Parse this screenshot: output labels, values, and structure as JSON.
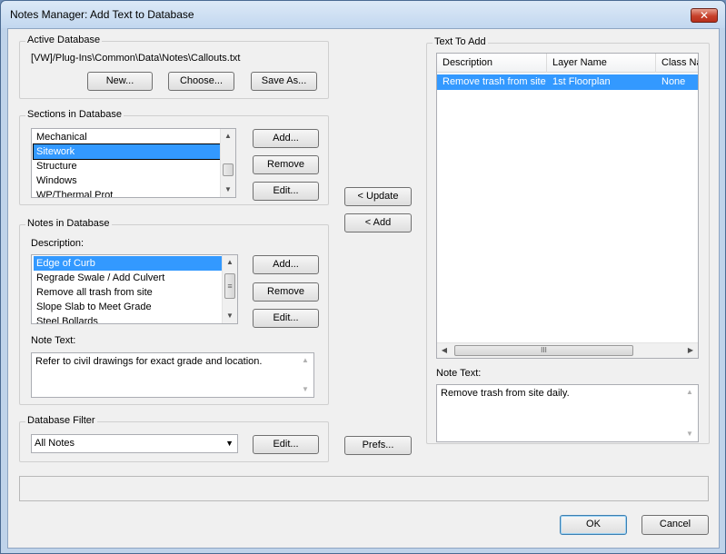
{
  "window": {
    "title": "Notes Manager: Add Text to Database",
    "close_glyph": "✕"
  },
  "active_database": {
    "title": "Active Database",
    "path": "[VW]/Plug-Ins\\Common\\Data\\Notes\\Callouts.txt",
    "new_label": "New...",
    "choose_label": "Choose...",
    "save_as_label": "Save As..."
  },
  "sections": {
    "title": "Sections in Database",
    "items": [
      "Mechanical",
      "Sitework",
      "Structure",
      "Windows",
      "WP/Thermal Prot"
    ],
    "selected": "Sitework",
    "add_label": "Add...",
    "remove_label": "Remove",
    "edit_label": "Edit..."
  },
  "notes": {
    "title": "Notes in Database",
    "description_label": "Description:",
    "items": [
      "Edge of Curb",
      "Regrade Swale / Add Culvert",
      "Remove all trash from site",
      "Slope Slab to Meet Grade",
      "Steel Bollards"
    ],
    "selected": "Edge of Curb",
    "add_label": "Add...",
    "remove_label": "Remove",
    "edit_label": "Edit...",
    "note_text_label": "Note Text:",
    "note_text": "Refer to civil drawings for exact grade and location."
  },
  "filter": {
    "title": "Database Filter",
    "value": "All Notes",
    "edit_label": "Edit..."
  },
  "middle": {
    "update_label": "< Update",
    "add_label": "< Add",
    "prefs_label": "Prefs..."
  },
  "text_to_add": {
    "title": "Text To Add",
    "columns": [
      "Description",
      "Layer Name",
      "Class Na"
    ],
    "row": {
      "description": "Remove trash from site",
      "layer": "1st Floorplan",
      "class": "None"
    },
    "note_text_label": "Note Text:",
    "note_text": "Remove trash from site daily."
  },
  "footer": {
    "ok_label": "OK",
    "cancel_label": "Cancel"
  },
  "colors": {
    "selection": "#3399ff",
    "title_bar": "#c2d7ef",
    "close": "#c7402a"
  },
  "icons": {
    "scroll_up": "▲",
    "scroll_down": "▼",
    "scroll_left": "◀",
    "scroll_right": "▶",
    "dropdown": "▼",
    "grip": "≡",
    "grip_h": "III"
  }
}
